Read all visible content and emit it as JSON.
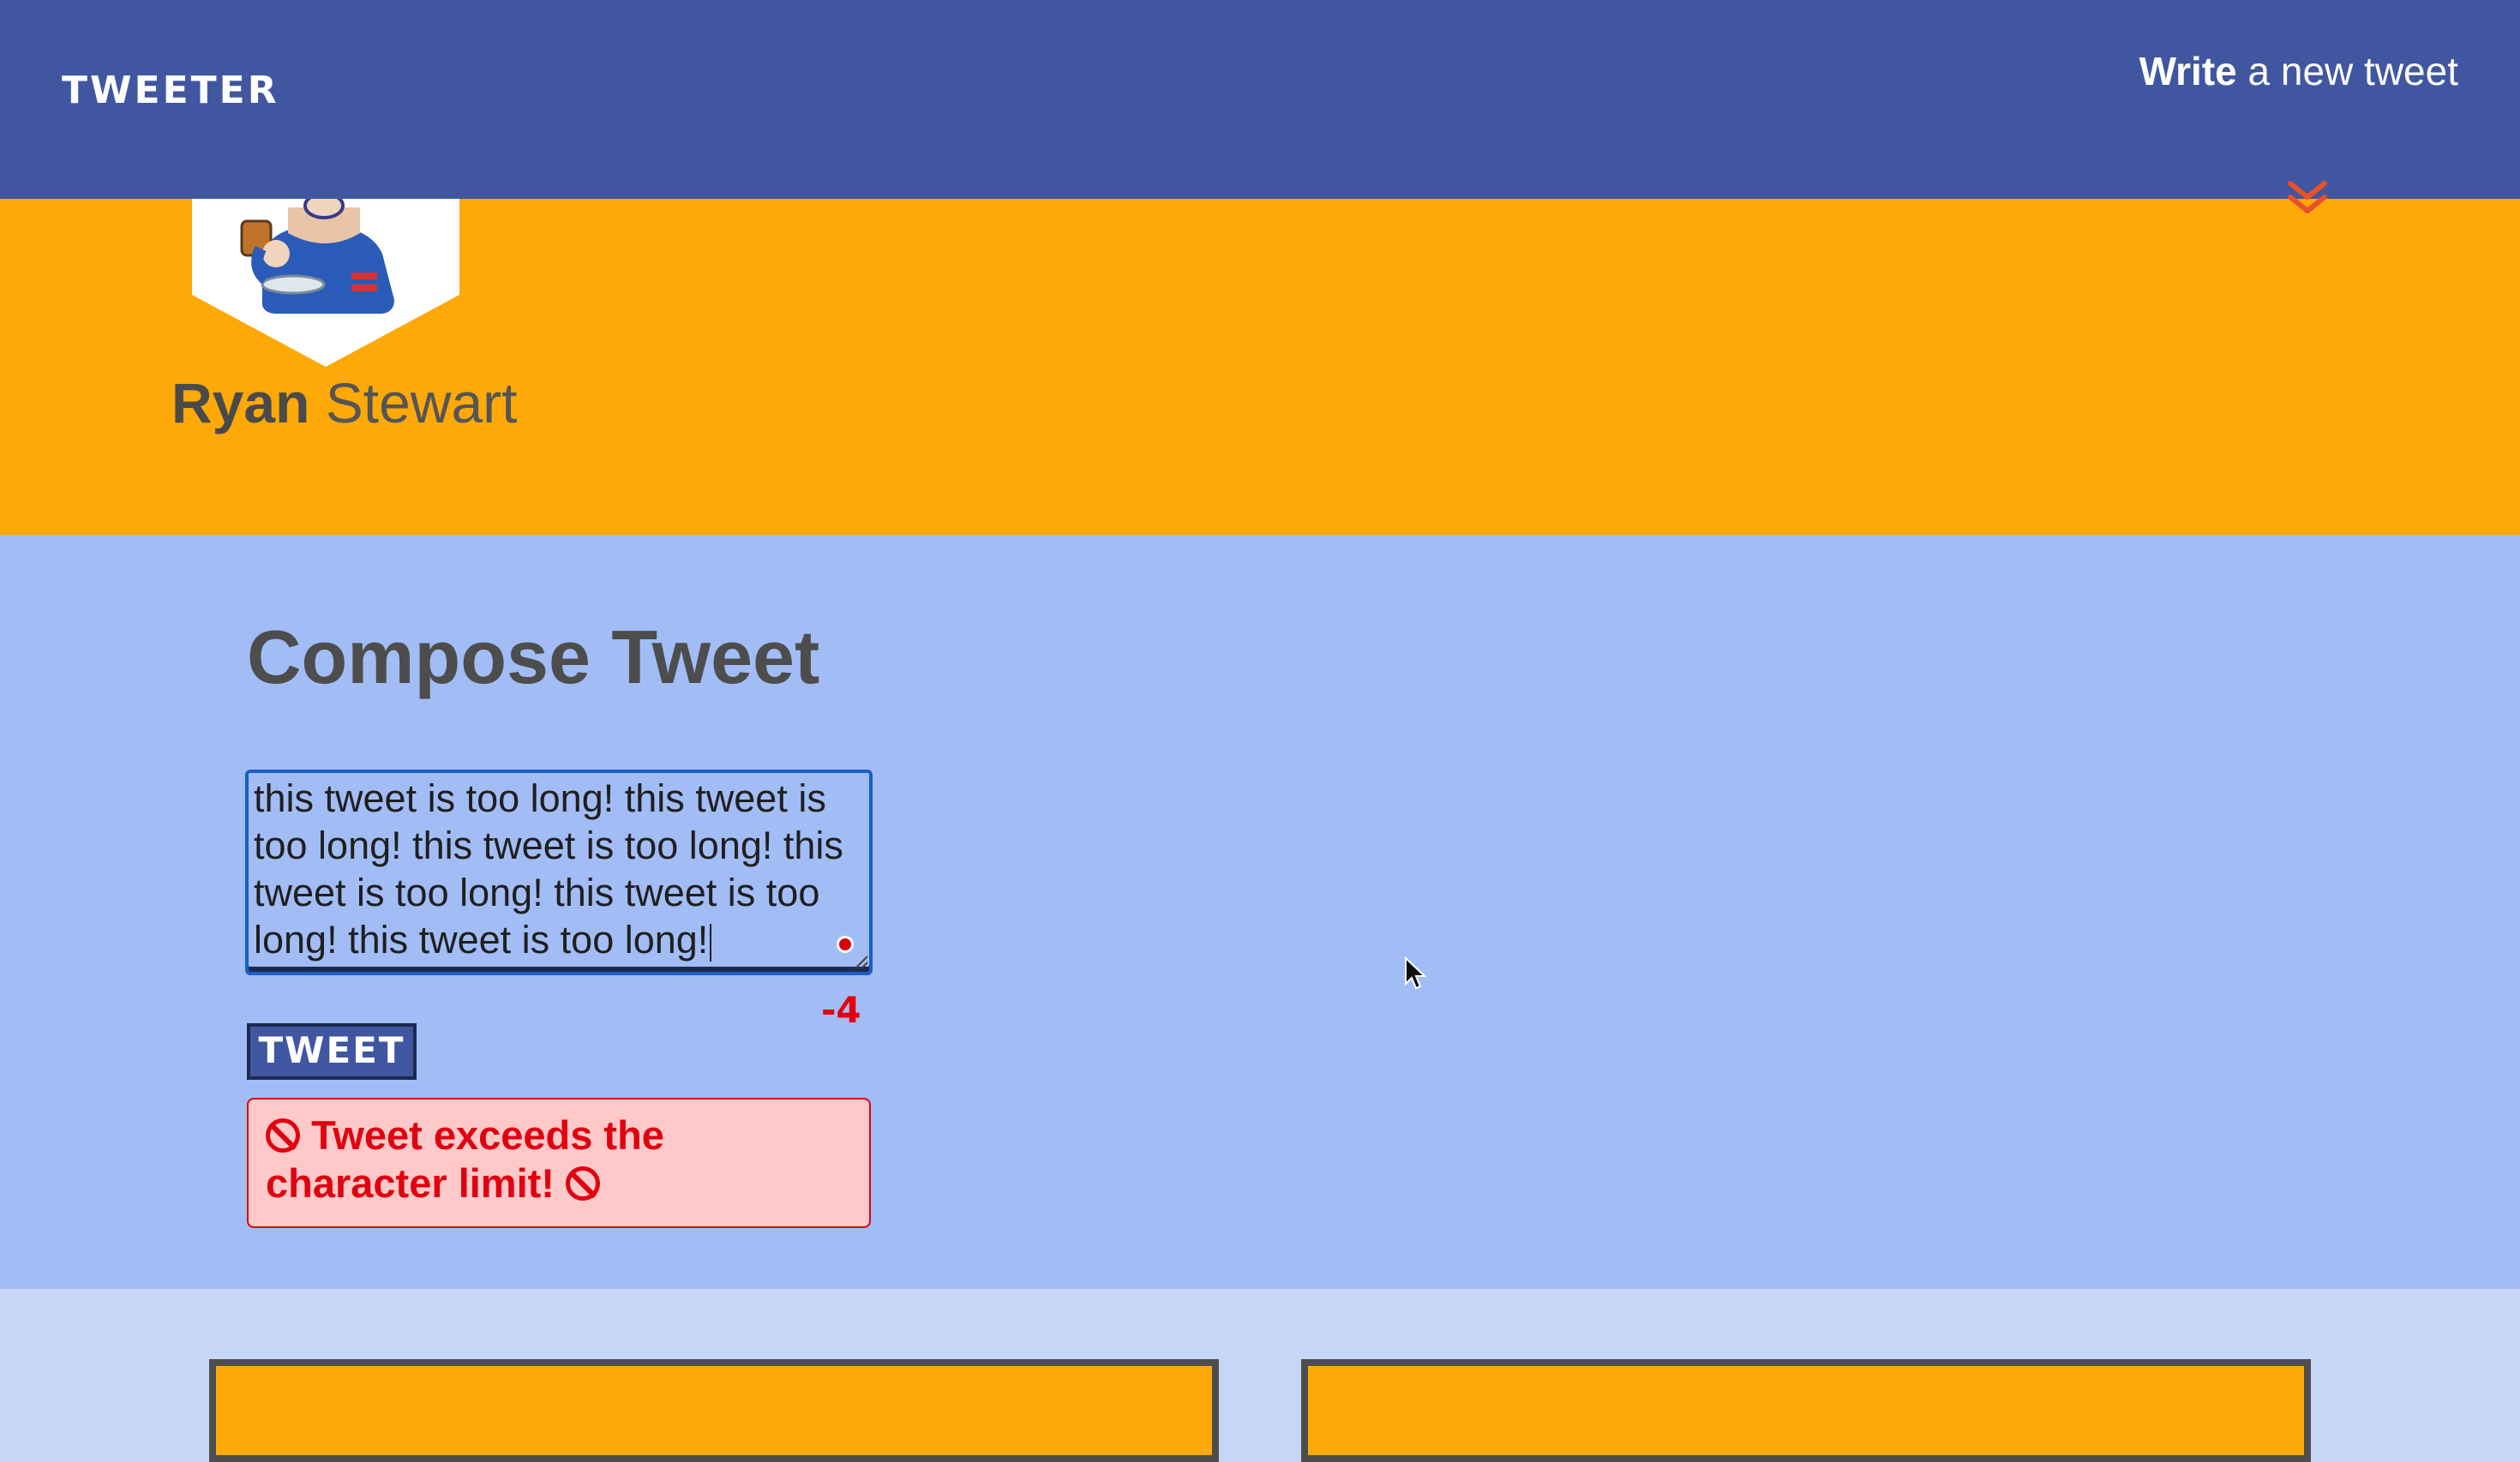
{
  "nav": {
    "brand": "TWEETER",
    "write_bold": "Write",
    "write_rest": " a new tweet"
  },
  "profile": {
    "first_name": "Ryan",
    "last_name": " Stewart"
  },
  "compose": {
    "title": "Compose Tweet",
    "textarea_value": "this tweet is too long! this tweet is too long! this tweet is too long! this tweet is too long! this tweet is too long! this tweet is too long!",
    "counter": "-4",
    "tweet_button": "TWEET",
    "error_message": "Tweet exceeds the character limit!"
  },
  "icons": {
    "nav_toggle": "double-chevron-down-icon",
    "error": "prohibited-icon"
  },
  "colors": {
    "nav": "#4056a1",
    "profile": "#ffa908",
    "compose": "#a2bdf5",
    "tweets": "#c6d6f7",
    "error": "#e0000f",
    "error_bg": "#ffc9c9",
    "chevron": "#e8502a"
  }
}
